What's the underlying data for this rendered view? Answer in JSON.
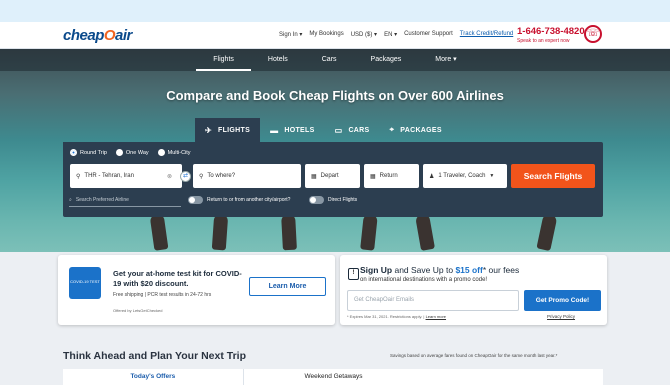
{
  "header": {
    "logo": {
      "part1": "cheap",
      "part2": "O",
      "part3": "air"
    },
    "links": [
      "Sign In ▾",
      "My Bookings",
      "USD ($) ▾",
      "EN ▾",
      "Customer Support"
    ],
    "track_link": "Track Credit/Refund",
    "phone": "1-646-738-4820",
    "phone_sub": "Speak to an expert now"
  },
  "nav": {
    "items": [
      "Flights",
      "Hotels",
      "Cars",
      "Packages",
      "More ▾"
    ],
    "active": "Flights"
  },
  "hero": {
    "title": "Compare and Book Cheap Flights on Over 600 Airlines",
    "tabs": [
      {
        "label": "FLIGHTS",
        "icon": "✈"
      },
      {
        "label": "HOTELS",
        "icon": "▬"
      },
      {
        "label": "CARS",
        "icon": "▭"
      },
      {
        "label": "PACKAGES",
        "icon": "⌖"
      }
    ]
  },
  "search": {
    "trip_types": [
      "Round Trip",
      "One Way",
      "Multi-City"
    ],
    "selected_trip": "Round Trip",
    "from_value": "THR - Tehran, Iran",
    "to_placeholder": "To where?",
    "depart_label": "Depart",
    "return_label": "Return",
    "travelers": "1 Traveler, Coach",
    "button_label": "Search Flights",
    "airline_placeholder": "Search Preferred Airline",
    "toggle_return": "Return to or from another city/airport?",
    "toggle_direct": "Direct Flights"
  },
  "test_card": {
    "kit_label": "COVID-19 TEST",
    "title": "Get your at-home test kit for COVID-19 with $20 discount.",
    "subtitle": "Free shipping | PCR test results in 24-72 hrs",
    "offered_by": "Offered by LetsGetChecked",
    "button": "Learn More"
  },
  "promo_card": {
    "title_a": "Sign Up",
    "title_b": " and Save Up to ",
    "title_c": "$15 off",
    "title_d": "* our fees",
    "subtitle": "on international destinations with a promo code!",
    "email_placeholder": "Get CheapOair Emails",
    "button": "Get Promo Code!",
    "fine_print": "* Expires Mar 31, 2021. Restrictions apply.",
    "learn_more": "Learn more",
    "privacy": "Privacy Policy"
  },
  "deals": {
    "title": "Think Ahead and Plan Your Next Trip",
    "note": "Savings based on average fares found on CheapOair for the same month last year.*",
    "tabs": [
      "Today's Offers",
      "Weekend Getaways"
    ]
  }
}
